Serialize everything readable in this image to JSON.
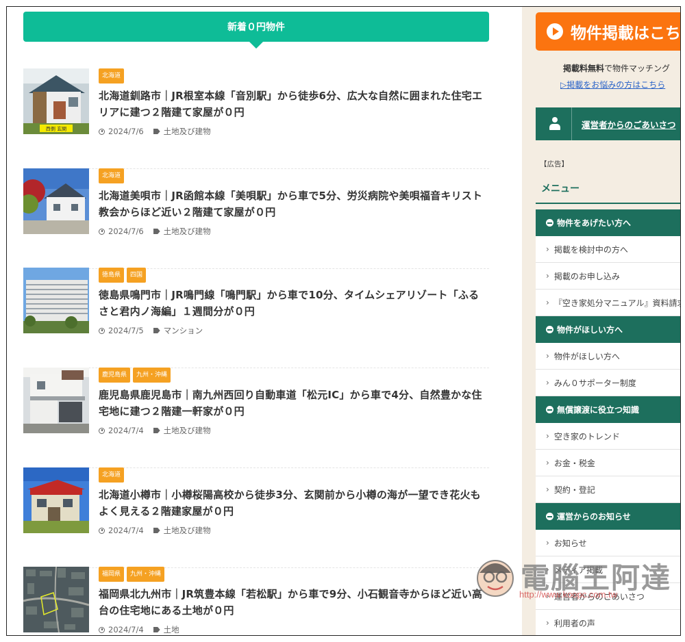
{
  "main": {
    "section_title": "新着０円物件",
    "posts": [
      {
        "tags": [
          "北海道"
        ],
        "title": "北海道釧路市｜JR根室本線「音別駅」から徒歩6分、広大な自然に囲まれた住宅エリアに建つ２階建て家屋が０円",
        "date": "2024/7/6",
        "category": "土地及び建物",
        "thumb_sign": "西側 玄関"
      },
      {
        "tags": [
          "北海道"
        ],
        "title": "北海道美唄市｜JR函館本線「美唄駅」から車で5分、労災病院や美唄福音キリスト教会からほど近い２階建て家屋が０円",
        "date": "2024/7/6",
        "category": "土地及び建物"
      },
      {
        "tags": [
          "徳島県",
          "四国"
        ],
        "title": "徳島県鳴門市｜JR鳴門線「鳴門駅」から車で10分、タイムシェアリゾート「ふるさと君内ノ海編」１週間分が０円",
        "date": "2024/7/5",
        "category": "マンション"
      },
      {
        "tags": [
          "鹿児島県",
          "九州・沖縄"
        ],
        "title": "鹿児島県鹿児島市｜南九州西回り自動車道「松元IC」から車で4分、自然豊かな住宅地に建つ２階建一軒家が０円",
        "date": "2024/7/4",
        "category": "土地及び建物"
      },
      {
        "tags": [
          "北海道"
        ],
        "title": "北海道小樽市｜小樽桜陽高校から徒歩3分、玄関前から小樽の海が一望でき花火もよく見える２階建家屋が０円",
        "date": "2024/7/4",
        "category": "土地及び建物"
      },
      {
        "tags": [
          "福岡県",
          "九州・沖縄"
        ],
        "title": "福岡県北九州市｜JR筑豊本線「若松駅」から車で9分、小石観音寺からほど近い高台の住宅地にある土地が０円",
        "date": "2024/7/4",
        "category": "土地"
      }
    ]
  },
  "sidebar": {
    "promo_label": "物件掲載はこちら",
    "promo_note_bold": "掲載料無料",
    "promo_note_rest": "で物件マッチング",
    "promo_link": "▷掲載をお悩みの方はこちら",
    "greeting": "運営者からのごあいさつ",
    "ad_label": "【広告】",
    "menu_title": "メニュー",
    "menu": [
      {
        "category": "物件をあげたい方へ",
        "items": [
          "掲載を検討中の方へ",
          "掲載のお申し込み",
          "『空き家処分マニュアル』資料請求"
        ]
      },
      {
        "category": "物件がほしい方へ",
        "items": [
          "物件がほしい方へ",
          "みん０サポーター制度"
        ]
      },
      {
        "category": "無償譲渡に役立つ知識",
        "items": [
          "空き家のトレンド",
          "お金・税金",
          "契約・登記"
        ]
      },
      {
        "category": "運営からのお知らせ",
        "items": [
          "お知らせ",
          "メディア掲載",
          "運営者からのごあいさつ",
          "利用者の声"
        ]
      }
    ]
  },
  "watermark": {
    "title": "電腦王阿達",
    "url": "http://www.koopc.com.tw"
  },
  "colors": {
    "accent_green": "#0ebc97",
    "sidebar_dark_green": "#1d6f5d",
    "tag_orange": "#f5a122",
    "promo_orange": "#fb7410",
    "sidebar_bg": "#f4ede2"
  }
}
